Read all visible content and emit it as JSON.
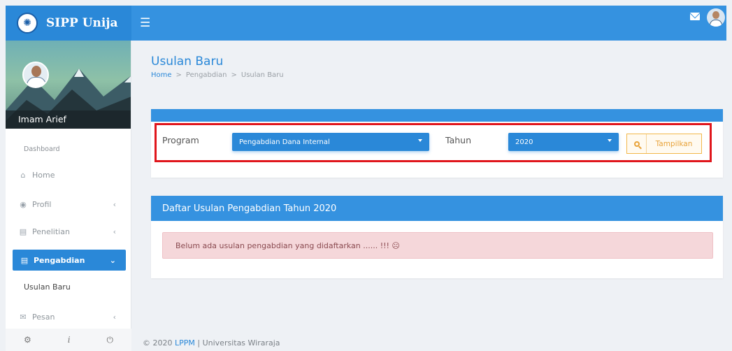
{
  "app": {
    "title": "SIPP Unija"
  },
  "user": {
    "name": "Imam Arief"
  },
  "sidebar": {
    "header": "Dashboard",
    "items": [
      {
        "label": "Home",
        "icon": "home-icon"
      },
      {
        "label": "Profil",
        "icon": "user-icon"
      },
      {
        "label": "Penelitian",
        "icon": "document-icon"
      },
      {
        "label": "Pengabdian",
        "icon": "document-icon"
      },
      {
        "label": "Pesan",
        "icon": "mail-icon"
      }
    ],
    "subitem": "Usulan Baru",
    "footer_icons": [
      "settings-icon",
      "info-icon",
      "power-icon"
    ]
  },
  "page": {
    "title": "Usulan Baru",
    "breadcrumb": [
      "Home",
      "Pengabdian",
      "Usulan Baru"
    ],
    "separator": ">"
  },
  "filter": {
    "program_label": "Program",
    "program_value": "Pengabdian Dana Internal",
    "year_label": "Tahun",
    "year_value": "2020",
    "button_label": "Tampilkan"
  },
  "list": {
    "title": "Daftar Usulan Pengabdian Tahun 2020",
    "empty_message": "Belum ada usulan pengabdian yang didaftarkan ...... !!! ☹"
  },
  "footer": {
    "prefix": "© 2020 ",
    "link": "LPPM",
    "suffix": " | Universitas Wiraraja"
  },
  "colors": {
    "primary": "#2a88d8",
    "topbar": "#3592e0",
    "highlight": "#e0161c",
    "warning": "#e8a33a",
    "alert_bg": "#f5d7da"
  }
}
